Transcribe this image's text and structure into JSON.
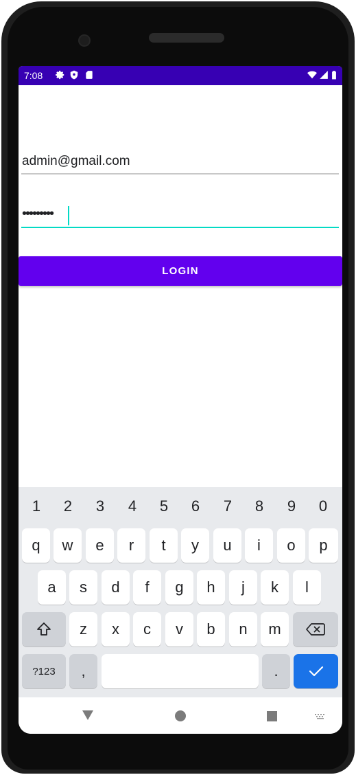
{
  "status_bar": {
    "time": "7:08",
    "left_icons": [
      "settings-icon",
      "shield-icon",
      "sd-card-icon"
    ],
    "right_icons": [
      "wifi-icon",
      "signal-icon",
      "battery-icon"
    ],
    "background": "#3700b3"
  },
  "login_form": {
    "email_value": "admin@gmail.com",
    "password_value": "•••••••••",
    "login_label": "LOGIN",
    "accent": "#6200ee",
    "focus_color": "#03dac5"
  },
  "keyboard": {
    "number_row": [
      "1",
      "2",
      "3",
      "4",
      "5",
      "6",
      "7",
      "8",
      "9",
      "0"
    ],
    "row1": [
      "q",
      "w",
      "e",
      "r",
      "t",
      "y",
      "u",
      "i",
      "o",
      "p"
    ],
    "row2": [
      "a",
      "s",
      "d",
      "f",
      "g",
      "h",
      "j",
      "k",
      "l"
    ],
    "row3": [
      "z",
      "x",
      "c",
      "v",
      "b",
      "n",
      "m"
    ],
    "symbols_label": "?123",
    "comma_label": ",",
    "period_label": ".",
    "enter_color": "#1a73e8"
  },
  "nav_bar": {
    "icons": [
      "back-icon",
      "home-icon",
      "recents-icon",
      "keyboard-switch-icon"
    ]
  }
}
